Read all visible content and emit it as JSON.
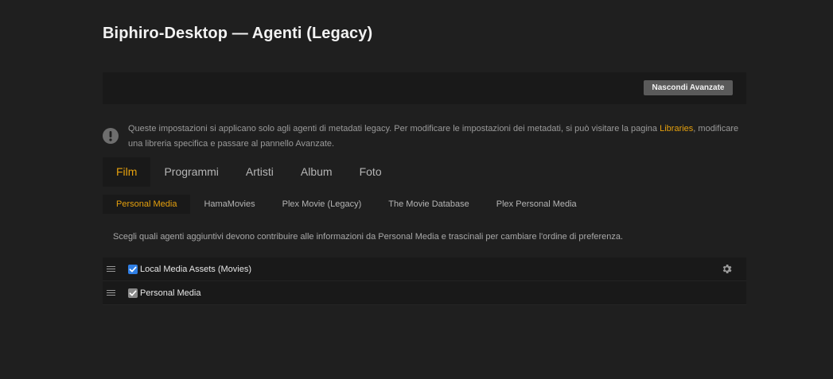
{
  "page": {
    "title": "Biphiro-Desktop — Agenti (Legacy)"
  },
  "toolbar": {
    "advanced_button_label": "Nascondi Avanzate"
  },
  "notice": {
    "icon": "exclamation-circle-icon",
    "text_before": "Queste impostazioni si applicano solo agli agenti di metadati legacy. Per modificare le impostazioni dei metadati, si può visitare la pagina ",
    "link_label": "Libraries",
    "text_after": ", modificare una libreria specifica e passare al pannello Avanzate."
  },
  "tabs": [
    {
      "label": "Film",
      "active": true
    },
    {
      "label": "Programmi",
      "active": false
    },
    {
      "label": "Artisti",
      "active": false
    },
    {
      "label": "Album",
      "active": false
    },
    {
      "label": "Foto",
      "active": false
    }
  ],
  "subtabs": [
    {
      "label": "Personal Media",
      "active": true
    },
    {
      "label": "HamaMovies",
      "active": false
    },
    {
      "label": "Plex Movie (Legacy)",
      "active": false
    },
    {
      "label": "The Movie Database",
      "active": false
    },
    {
      "label": "Plex Personal Media",
      "active": false
    }
  ],
  "hint": "Scegli quali agenti aggiuntivi devono contribuire alle informazioni da Personal Media e trascinali per cambiare l'ordine di preferenza.",
  "agents": [
    {
      "name": "Local Media Assets (Movies)",
      "checked": true,
      "enabled": true,
      "has_settings": true
    },
    {
      "name": "Personal Media",
      "checked": true,
      "enabled": false,
      "has_settings": false
    }
  ],
  "colors": {
    "accent": "#e5a00d",
    "background": "#1f1f1f",
    "panel": "#191919",
    "checkbox_active": "#2f7ee3",
    "checkbox_disabled": "#8a8a8a"
  }
}
